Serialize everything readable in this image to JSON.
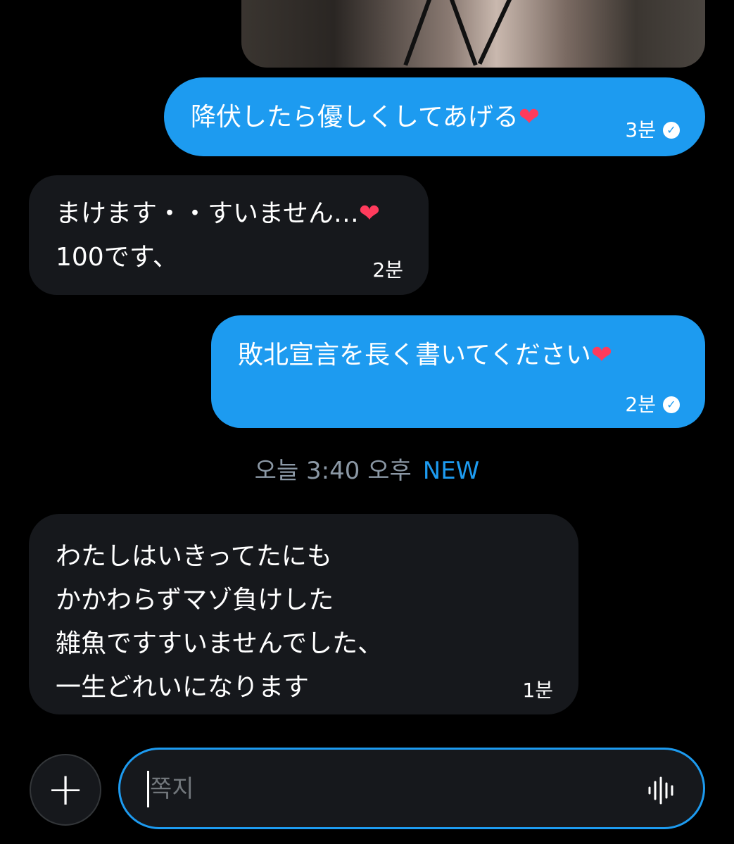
{
  "thread": {
    "messages": [
      {
        "direction": "out",
        "text": "降伏したら優しくしてあげる",
        "emoji": "❤",
        "time": "3분",
        "read": true
      },
      {
        "direction": "in",
        "line1": "まけます・・すいません…",
        "emoji": "❤",
        "line2": "100です、",
        "time": "2분"
      },
      {
        "direction": "out",
        "text": "敗北宣言を長く書いてください",
        "emoji": "❤",
        "time": "2분",
        "read": true
      },
      {
        "direction": "in",
        "text": "わたしはいきってたにも\nかかわらずマゾ負けした\n雑魚ですすいませんでした、\n一生どれいになります",
        "time": "1분"
      }
    ],
    "divider": {
      "time": "오늘 3:40 오후",
      "badge": "NEW"
    }
  },
  "composer": {
    "add_label": "+",
    "placeholder": "쪽지",
    "voice_icon": "voice-waveform-icon"
  },
  "colors": {
    "accent": "#1d9bf0",
    "incoming_bubble": "#16181c",
    "background": "#000000"
  }
}
